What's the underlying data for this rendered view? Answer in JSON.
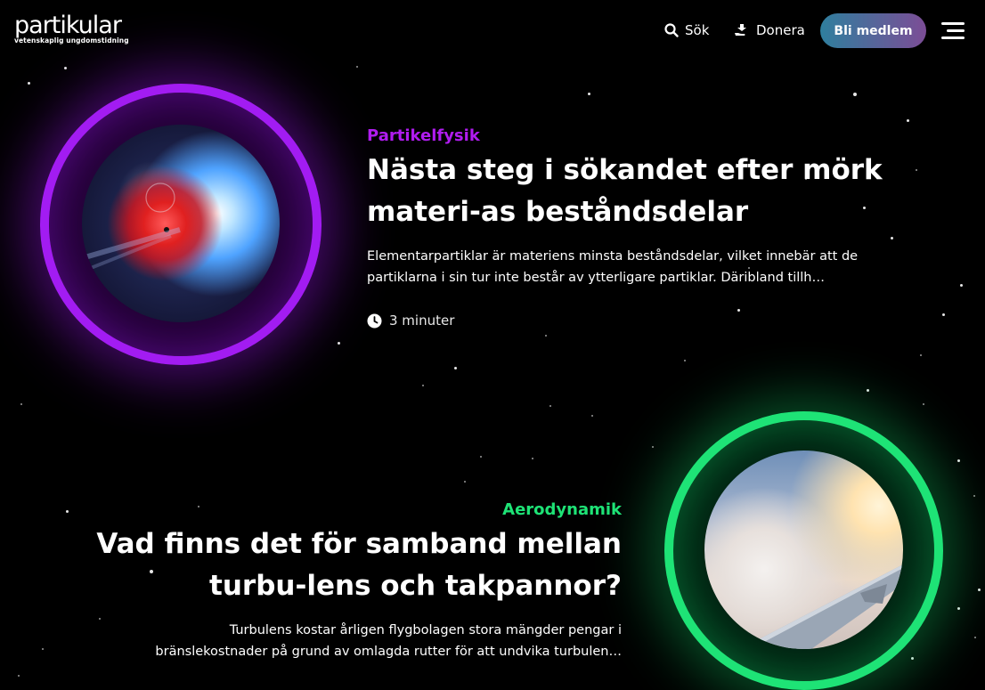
{
  "header": {
    "logo_text": "partikular",
    "logo_subtitle": "vetenskaplig ungdomstidning",
    "search_label": "Sök",
    "donate_label": "Donera",
    "member_button": "Bli medlem"
  },
  "articles": [
    {
      "category": "Partikelfysik",
      "title": "Nästa steg i sökandet efter mörk materi-as beståndsdelar",
      "excerpt": "Elementarpartiklar är materiens minsta beståndsdelar, vilket innebär att de partiklarna i sin tur inte består av ytterligare partiklar. Däribland tillh…",
      "read_time": "3 minuter",
      "accent": "#a21cf2"
    },
    {
      "category": "Aerodynamik",
      "title": "Vad finns det för samband mellan turbu-lens och takpannor?",
      "excerpt": "Turbulens kostar årligen flygbolagen stora mängder pengar i bränslekostnader på grund av omlagda rutter för att undvika turbulen…",
      "accent": "#1ee376"
    }
  ],
  "icons": {
    "search": "search-icon",
    "donate": "donate-icon",
    "menu": "hamburger-menu-icon",
    "clock": "clock-icon"
  }
}
